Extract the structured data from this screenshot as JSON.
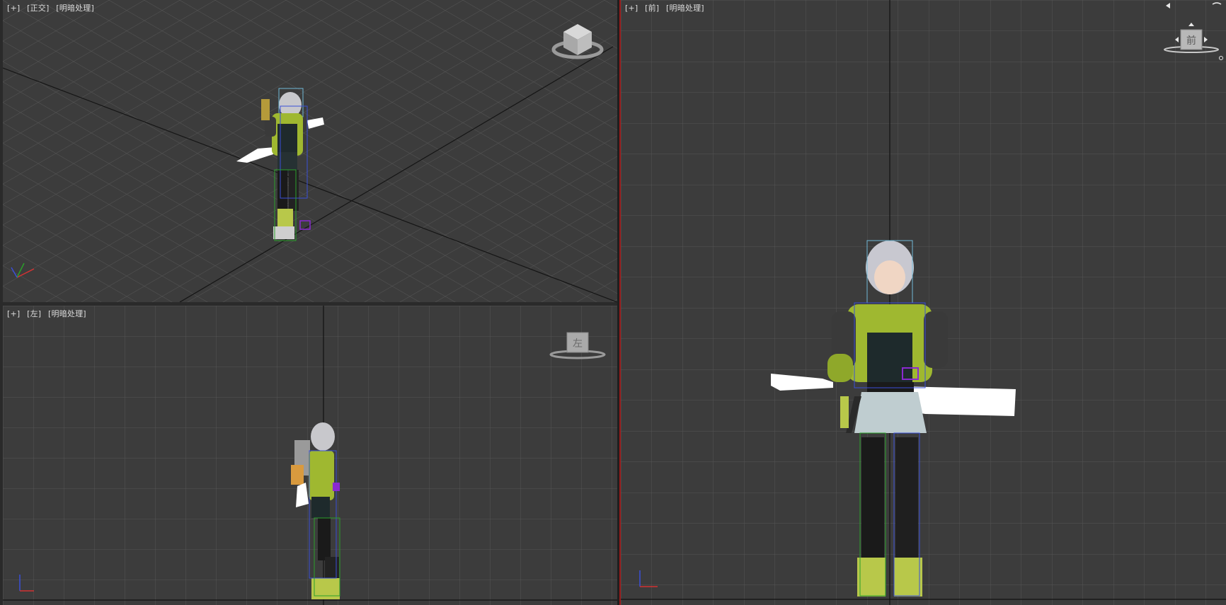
{
  "viewports": {
    "perspective": {
      "labels": [
        "[+]",
        "[正交]",
        "[明暗处理]"
      ]
    },
    "left": {
      "labels": [
        "[+]",
        "[左]",
        "[明暗处理]"
      ],
      "viewcube_text": "左"
    },
    "front": {
      "labels": [
        "[+]",
        "[前]",
        "[明暗处理]"
      ],
      "viewcube_text": "前"
    }
  },
  "colors": {
    "viewport_bg": "#3c3c3c",
    "grid": "#555555",
    "axis": "#111111",
    "active_border": "#9b1a1a",
    "armor": "#9fb830",
    "bone_blue": "#3a4fd8",
    "bone_green": "#2aa02a",
    "bone_purple": "#8a2ad0"
  }
}
